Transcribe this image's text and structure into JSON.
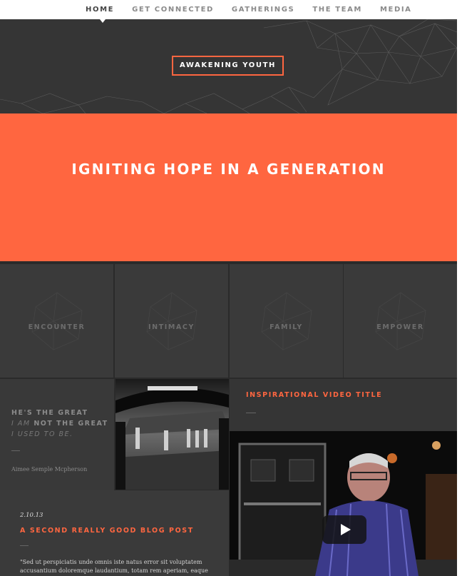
{
  "nav": {
    "items": [
      {
        "label": "HOME",
        "active": true
      },
      {
        "label": "GET CONNECTED",
        "active": false
      },
      {
        "label": "GATHERINGS",
        "active": false
      },
      {
        "label": "THE TEAM",
        "active": false
      },
      {
        "label": "MEDIA",
        "active": false
      }
    ]
  },
  "header": {
    "brand": "AWAKENING YOUTH"
  },
  "hero": {
    "title": "IGNITING HOPE IN A GENERATION"
  },
  "tiles": [
    {
      "label": "ENCOUNTER"
    },
    {
      "label": "INTIMACY"
    },
    {
      "label": "FAMILY"
    },
    {
      "label": "EMPOWER"
    }
  ],
  "quote": {
    "line1": "HE'S THE GREAT",
    "line2_a": "I AM",
    "line2_b": " NOT THE GREAT",
    "line3": "I USED TO BE.",
    "author": "Aimee Semple Mcpherson"
  },
  "video": {
    "title": "INSPIRATIONAL VIDEO TITLE"
  },
  "blog": {
    "date": "2.10.13",
    "title": "A SECOND REALLY GOOD BLOG POST",
    "excerpt": "\"Sed ut perspiciatis unde omnis iste natus error sit voluptatem accusantium doloremque laudantium, totam rem aperiam, eaque"
  },
  "colors": {
    "accent": "#ff6640",
    "dark": "#353535",
    "tile": "#3a3a3a",
    "nav_bg": "#ffffff"
  },
  "icons": [
    "play-icon",
    "crystal-icon",
    "network-pattern"
  ]
}
